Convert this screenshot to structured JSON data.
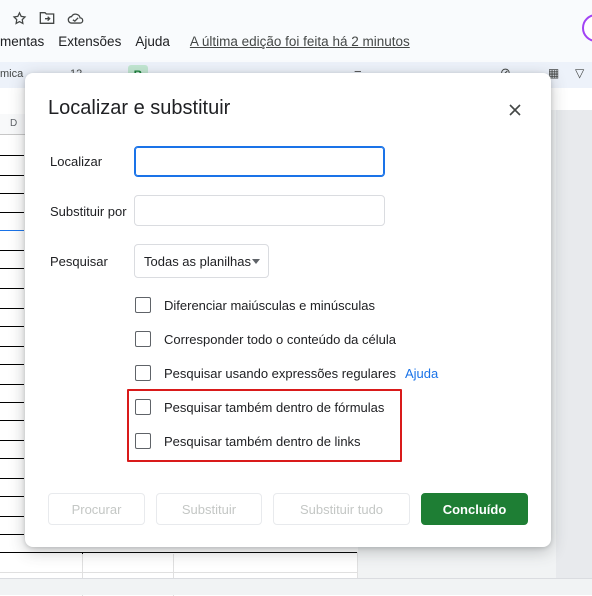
{
  "app": {
    "menus": [
      "mentas",
      "Extensões",
      "Ajuda"
    ],
    "last_edit": "A última edição foi feita há 2 minutos",
    "toolbar_font": "mica",
    "toolbar_size": "12",
    "toolbar_bold": "B",
    "column_header": "D"
  },
  "dialog": {
    "title": "Localizar e substituir",
    "find_label": "Localizar",
    "find_value": "",
    "replace_label": "Substituir por",
    "replace_value": "",
    "search_label": "Pesquisar",
    "search_scope": "Todas as planilhas",
    "options": [
      {
        "label": "Diferenciar maiúsculas e minúsculas",
        "checked": false
      },
      {
        "label": "Corresponder todo o conteúdo da célula",
        "checked": false
      },
      {
        "label": "Pesquisar usando expressões regulares",
        "checked": false
      },
      {
        "label": "Pesquisar também dentro de fórmulas",
        "checked": false
      },
      {
        "label": "Pesquisar também dentro de links",
        "checked": false
      }
    ],
    "help_link": "Ajuda",
    "buttons": {
      "find": "Procurar",
      "replace": "Substituir",
      "replace_all": "Substituir tudo",
      "done": "Concluído"
    }
  },
  "colors": {
    "primary_button": "#1e7e34",
    "focus": "#1a73e8",
    "highlight_box": "#d91a1a",
    "link": "#1a73e8"
  }
}
